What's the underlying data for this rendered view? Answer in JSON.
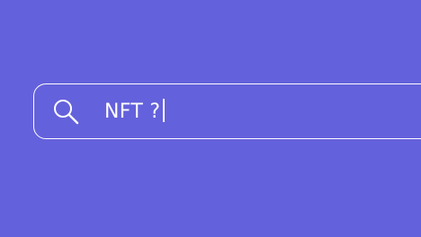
{
  "search": {
    "query": "NFT ?",
    "icon": "search-icon"
  },
  "colors": {
    "background": "#6461dc",
    "foreground": "#ffffff"
  }
}
